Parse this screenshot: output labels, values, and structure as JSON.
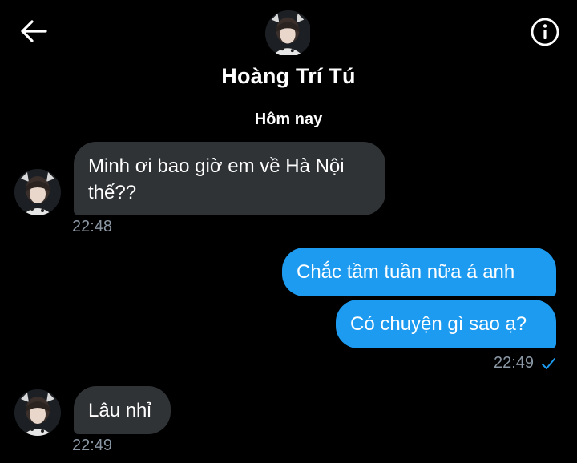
{
  "header": {
    "contact_name": "Hoàng Trí Tú",
    "back_icon": "arrow-left-icon",
    "info_icon": "info-icon"
  },
  "date_separator": "Hôm nay",
  "colors": {
    "background": "#000000",
    "incoming_bubble": "#2f3336",
    "outgoing_bubble": "#1d9bf0",
    "timestamp": "#8b98a5"
  },
  "messages": [
    {
      "direction": "incoming",
      "text": "Minh ơi bao giờ em về Hà Nội thế??",
      "time": "22:48"
    },
    {
      "direction": "outgoing",
      "text": "Chắc tầm tuần nữa á anh"
    },
    {
      "direction": "outgoing",
      "text": "Có chuyện gì sao ạ?",
      "time": "22:49",
      "status_icon": "check-icon"
    },
    {
      "direction": "incoming",
      "text": "Lâu nhỉ",
      "time": "22:49"
    }
  ]
}
